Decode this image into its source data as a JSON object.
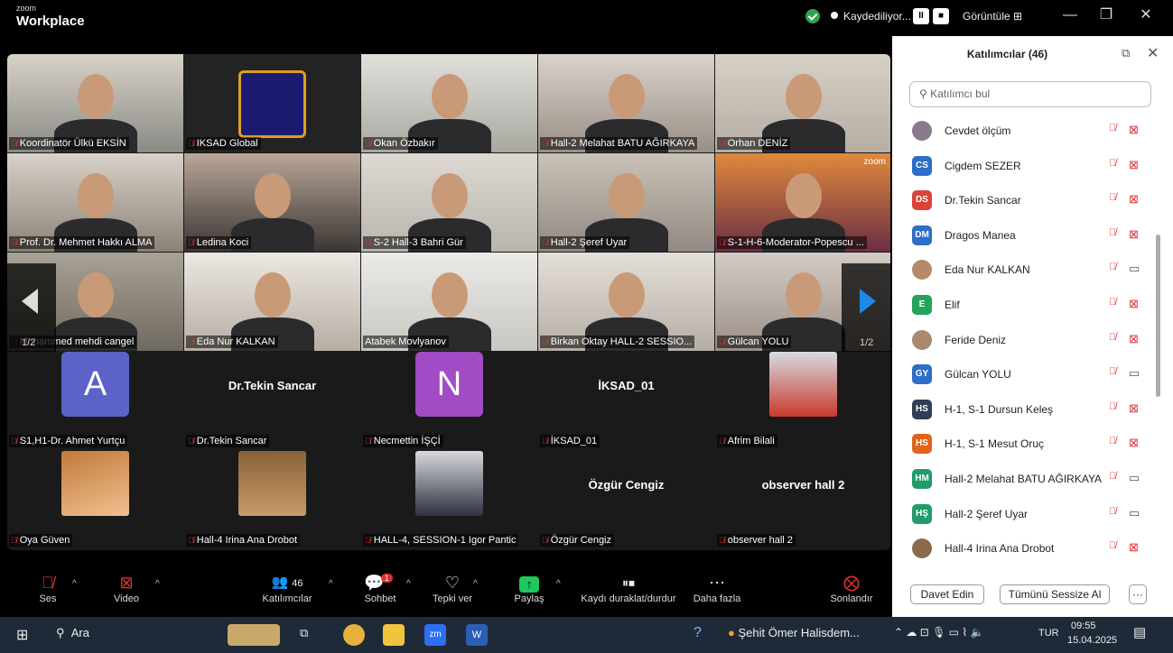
{
  "app": {
    "brand_small": "zoom",
    "brand_big": "Workplace"
  },
  "titlebar": {
    "recording": "Kaydediliyor...",
    "view": "Görüntüle",
    "minimize": "—",
    "maximize": "❐",
    "close": "✕"
  },
  "grid": {
    "page": "1/2",
    "tiles": [
      {
        "name": "Koordinatör Ülkü EKSİN",
        "type": "video"
      },
      {
        "name": "IKSAD Global",
        "type": "logo"
      },
      {
        "name": "Okan Özbakır",
        "type": "video"
      },
      {
        "name": "Hall-2 Melahat BATU AĞIRKAYA",
        "type": "video"
      },
      {
        "name": "Orhan DENİZ",
        "type": "video"
      },
      {
        "name": "Prof. Dr. Mehmet Hakkı ALMA",
        "type": "video"
      },
      {
        "name": "Ledina Koci",
        "type": "video"
      },
      {
        "name": "S-2  Hall-3 Bahri Gür",
        "type": "video"
      },
      {
        "name": "Hall-2 Şeref Uyar",
        "type": "video"
      },
      {
        "name": "S-1-H-6-Moderator-Popescu ...",
        "type": "video",
        "overlay": "zoom"
      },
      {
        "name": "Muhammed mehdi cangel",
        "type": "video"
      },
      {
        "name": "Eda Nur KALKAN",
        "type": "video"
      },
      {
        "name": "Atabek Movlyanov",
        "type": "video",
        "active": true
      },
      {
        "name": "Birkan Oktay HALL-2  SESSIO...",
        "type": "video"
      },
      {
        "name": "Gülcan YOLU",
        "type": "video"
      },
      {
        "name": "S1,H1-Dr. Ahmet Yurtçu",
        "type": "letter",
        "letter": "A",
        "color": "#5b63c8"
      },
      {
        "name": "Dr.Tekin Sancar",
        "type": "text",
        "big": "Dr.Tekin Sancar"
      },
      {
        "name": "Necmettin İŞÇİ",
        "type": "letter",
        "letter": "N",
        "color": "#a34bc4"
      },
      {
        "name": "İKSAD_01",
        "type": "text",
        "big": "İKSAD_01"
      },
      {
        "name": "Afrim Bilali",
        "type": "photo"
      },
      {
        "name": "Oya Güven",
        "type": "photo"
      },
      {
        "name": "Hall-4 Irina Ana Drobot",
        "type": "photo"
      },
      {
        "name": "HALL-4, SESSION-1 Igor Pantic",
        "type": "photo"
      },
      {
        "name": "Özgür Cengiz",
        "type": "text",
        "big": "Özgür Cengiz"
      },
      {
        "name": "observer hall 2",
        "type": "text",
        "big": "observer hall 2"
      }
    ]
  },
  "toolbar": {
    "audio": "Ses",
    "video": "Video",
    "participants": "Katılımcılar",
    "participants_count": "46",
    "chat": "Sohbet",
    "chat_badge": "1",
    "react": "Tepki ver",
    "share": "Paylaş",
    "record": "Kaydı duraklat/durdur",
    "more": "Daha fazla",
    "end": "Sonlandır"
  },
  "sidebar": {
    "title": "Katılımcılar (46)",
    "search_placeholder": "Katılımcı bul",
    "participants": [
      {
        "initials": "",
        "name": "Cevdet ölçüm",
        "color": "#8a7a90",
        "cam": "off"
      },
      {
        "initials": "CS",
        "name": "Cigdem SEZER",
        "color": "#2d6ec9",
        "cam": "off"
      },
      {
        "initials": "DS",
        "name": "Dr.Tekin Sancar",
        "color": "#d9433a",
        "cam": "off"
      },
      {
        "initials": "DM",
        "name": "Dragos Manea",
        "color": "#2d6ec9",
        "cam": "off"
      },
      {
        "initials": "",
        "name": "Eda Nur KALKAN",
        "color": "#b58a6a",
        "cam": "on"
      },
      {
        "initials": "E",
        "name": "Elif",
        "color": "#23a55a",
        "cam": "off"
      },
      {
        "initials": "",
        "name": "Feride Deniz",
        "color": "#a88a70",
        "cam": "off"
      },
      {
        "initials": "GY",
        "name": "Gülcan YOLU",
        "color": "#2d6ec9",
        "cam": "on"
      },
      {
        "initials": "HS",
        "name": "H-1, S-1 Dursun Keleş",
        "color": "#2f3e57",
        "cam": "off"
      },
      {
        "initials": "HS",
        "name": "H-1, S-1 Mesut Oruç",
        "color": "#e0641c",
        "cam": "off"
      },
      {
        "initials": "HM",
        "name": "Hall-2 Melahat BATU AĞIRKAYA",
        "color": "#1f9c6a",
        "cam": "on"
      },
      {
        "initials": "HŞ",
        "name": "Hall-2 Şeref Uyar",
        "color": "#1f9c6a",
        "cam": "on"
      },
      {
        "initials": "",
        "name": "Hall-4 Irina Ana Drobot",
        "color": "#8a6a4a",
        "cam": "off"
      }
    ],
    "invite": "Davet Edin",
    "mute_all": "Tümünü Sessize Al",
    "more": "···"
  },
  "taskbar": {
    "search": "Ara",
    "news": "Şehit Ömer Halisdem...",
    "lang": "TUR",
    "time": "09:55",
    "date": "15.04.2025"
  },
  "colors": {
    "mic_off": "#e0302f",
    "active_speaker": "#22c55e",
    "end": "#e0302f",
    "share": "#1ec760"
  }
}
